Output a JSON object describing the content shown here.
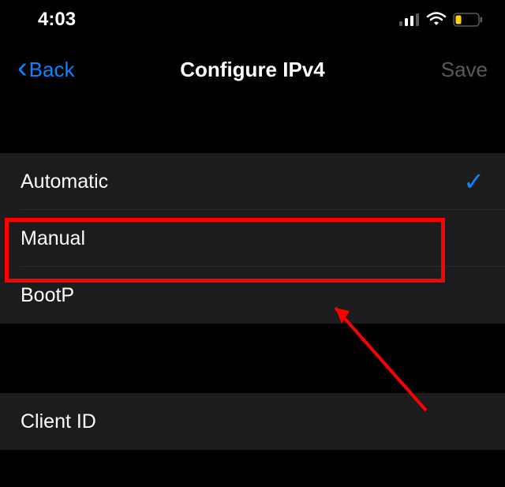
{
  "status": {
    "time": "4:03"
  },
  "nav": {
    "back_label": "Back",
    "title": "Configure IPv4",
    "save_label": "Save"
  },
  "options": {
    "automatic": "Automatic",
    "manual": "Manual",
    "bootp": "BootP"
  },
  "client_id": {
    "label": "Client ID"
  },
  "annotations": {
    "highlight_target": "manual",
    "arrow": true
  }
}
